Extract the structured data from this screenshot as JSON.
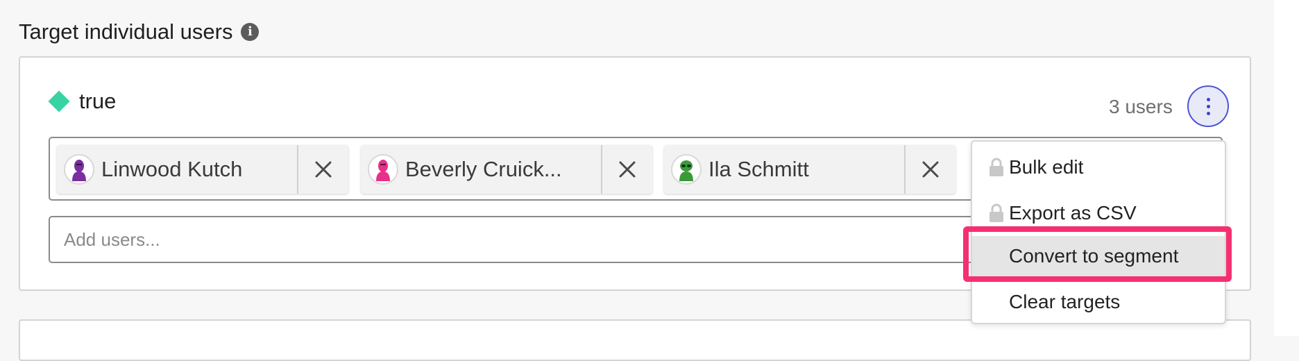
{
  "section": {
    "title": "Target individual users",
    "info_icon": "info-icon"
  },
  "variation": {
    "label": "true",
    "color": "#36d3a3",
    "user_count": "3 users"
  },
  "targets": [
    {
      "name": "Linwood Kutch",
      "avatar_color": "#7a2ea0"
    },
    {
      "name": "Beverly Cruick...",
      "avatar_color": "#e8308a"
    },
    {
      "name": "Ila Schmitt",
      "avatar_color": "#3a9a3a"
    }
  ],
  "add_users": {
    "placeholder": "Add users..."
  },
  "menu": {
    "items": [
      {
        "label": "Bulk edit",
        "locked": true
      },
      {
        "label": "Export as CSV",
        "locked": true
      },
      {
        "label": "Convert to segment",
        "locked": false,
        "highlighted": true
      },
      {
        "label": "Clear targets",
        "locked": false
      }
    ]
  },
  "colors": {
    "accent": "#4d55d6",
    "highlight": "#f53071"
  }
}
